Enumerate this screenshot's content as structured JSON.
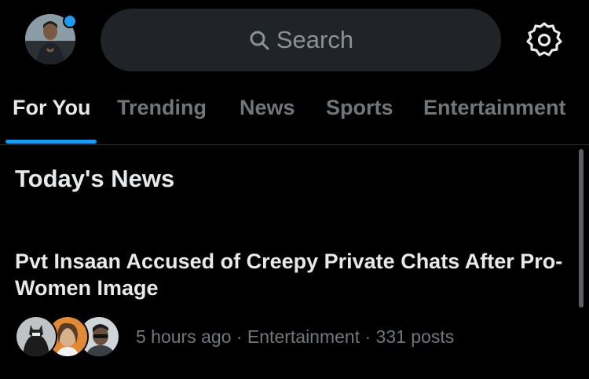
{
  "header": {
    "search_placeholder": "Search",
    "accent_color": "#1d9bf0"
  },
  "tabs": [
    {
      "label": "For You",
      "active": true
    },
    {
      "label": "Trending",
      "active": false
    },
    {
      "label": "News",
      "active": false
    },
    {
      "label": "Sports",
      "active": false
    },
    {
      "label": "Entertainment",
      "active": false
    }
  ],
  "section": {
    "title": "Today's News"
  },
  "news_item": {
    "headline": "Pvt Insaan Accused of Creepy Private Chats After Pro-Women Image",
    "meta": "5 hours ago · Entertainment · 331 posts"
  },
  "icons": [
    "profile-avatar",
    "notification-dot",
    "search-icon",
    "gear-icon"
  ]
}
